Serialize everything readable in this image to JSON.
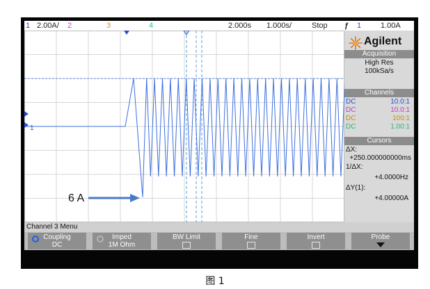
{
  "topbar": {
    "ch1_num": "1",
    "ch1_scale": "2.00A/",
    "ch2_num": "2",
    "ch3_num": "3",
    "ch4_num": "4",
    "timebase_pos": "2.000s",
    "timebase_scale": "1.000s/",
    "run_state": "Stop",
    "trigger_icon": "trigger-edge-icon",
    "trigger_ch": "1",
    "trigger_level": "1.00A"
  },
  "brand": {
    "logo": "agilent-spark-logo",
    "name": "Agilent"
  },
  "acquisition": {
    "title": "Acquisition",
    "mode": "High Res",
    "rate": "100kSa/s"
  },
  "channels": {
    "title": "Channels",
    "rows": [
      {
        "coupling": "DC",
        "probe": "10.0:1",
        "color": "#2a4fd4"
      },
      {
        "coupling": "DC",
        "probe": "10.0:1",
        "color": "#d03ad0"
      },
      {
        "coupling": "DC",
        "probe": "100:1",
        "color": "#d89a1c"
      },
      {
        "coupling": "DC",
        "probe": "1.00:1",
        "color": "#2fbf7a"
      }
    ]
  },
  "cursors": {
    "title": "Cursors",
    "dx_label": "ΔX:",
    "dx_value": "+250.000000000ms",
    "inv_label": "1/ΔX:",
    "inv_value": "+4.0000Hz",
    "dy_label": "ΔY(1):",
    "dy_value": "+4.00000A"
  },
  "screen": {
    "annotation": "6 A",
    "ch1_marker": "1",
    "trace_color": "#3b6fe0",
    "arrow_color": "#4a78c8"
  },
  "menu": {
    "title": "Channel 3 Menu",
    "softkeys": [
      {
        "label": "Coupling",
        "value": "DC",
        "icon": "rotary-knob-icon"
      },
      {
        "label": "Imped",
        "value": "1M Ohm",
        "icon": "rotary-knob-icon"
      },
      {
        "label": "BW Limit"
      },
      {
        "label": "Fine"
      },
      {
        "label": "Invert"
      },
      {
        "label": "Probe",
        "icon": "down-arrow-icon"
      }
    ]
  },
  "caption": "图 1",
  "colors": {
    "ch1": "#2a4fd4",
    "ch2": "#d03ad0",
    "ch3": "#d89a1c",
    "ch4": "#2fbf7a",
    "panel_title": "#8c8c8c"
  }
}
